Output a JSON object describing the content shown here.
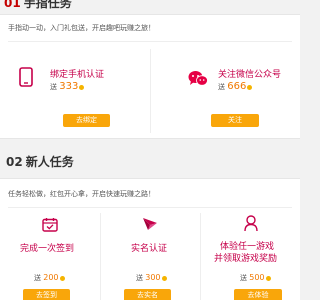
{
  "section1": {
    "number": "01",
    "title": "手指任务",
    "hint": "手指动一动，入门礼包送，开启趣吧玩赚之旅！",
    "tasks": [
      {
        "title": "绑定手机认证",
        "reward_prefix": "送",
        "amount": "333",
        "button": "去绑定",
        "icon": "phone-icon"
      },
      {
        "title": "关注微信公众号",
        "reward_prefix": "送",
        "amount": "666",
        "button": "关注",
        "icon": "wechat-icon"
      }
    ]
  },
  "section2": {
    "number": "02",
    "title": "新人任务",
    "hint": "任务轻松做，红包开心拿，开启快速玩赚之路！",
    "tasks": [
      {
        "title": "完成一次签到",
        "reward_prefix": "送",
        "amount": "200",
        "button": "去签到",
        "icon": "calendar-check-icon"
      },
      {
        "title": "实名认证",
        "reward_prefix": "送",
        "amount": "300",
        "button": "去实名",
        "icon": "send-arrow-icon"
      },
      {
        "title_line1": "体验任一游戏",
        "title_line2": "并领取游戏奖励",
        "reward_prefix": "送",
        "amount": "500",
        "button": "去体验",
        "icon": "user-icon"
      }
    ]
  },
  "colors": {
    "accent": "#c6004a",
    "button": "#f9a60a",
    "amount": "#f07800",
    "coin": "#f5b400",
    "section_number": "#c40000"
  }
}
